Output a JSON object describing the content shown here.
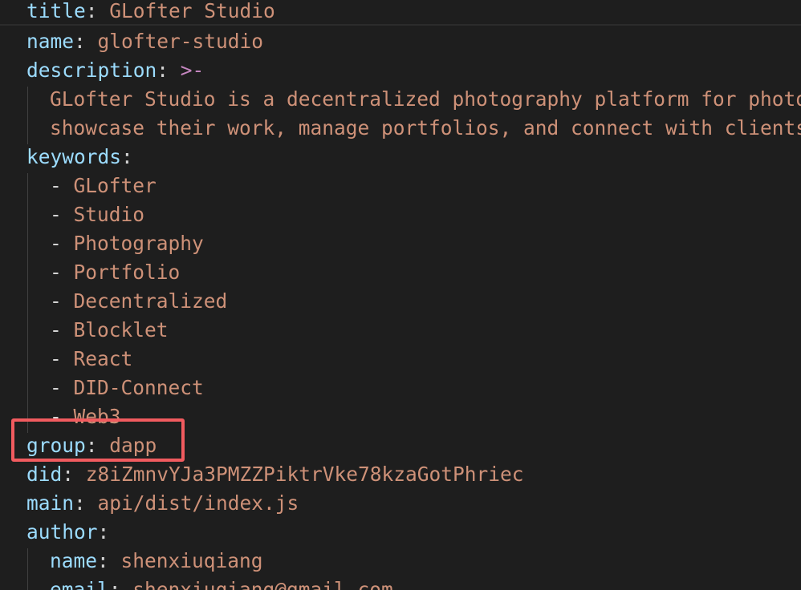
{
  "code": {
    "title_key": "title",
    "title_value": "GLofter Studio",
    "name_key": "name",
    "name_value": "glofter-studio",
    "description_key": "description",
    "description_indicator": ">-",
    "description_lines": [
      "GLofter Studio is a decentralized photography platform for photog",
      "showcase their work, manage portfolios, and connect with clients."
    ],
    "keywords_key": "keywords",
    "keywords": [
      "GLofter",
      "Studio",
      "Photography",
      "Portfolio",
      "Decentralized",
      "Blocklet",
      "React",
      "DID-Connect",
      "Web3"
    ],
    "group_key": "group",
    "group_value": "dapp",
    "did_key": "did",
    "did_value": "z8iZmnvYJa3PMZZPiktrVke78kzaGotPhriec",
    "main_key": "main",
    "main_value": "api/dist/index.js",
    "author_key": "author",
    "author_name_key": "name",
    "author_name_value": "shenxiuqiang",
    "author_email_key": "email",
    "author_email_value": "shenxiuqiang@gmail.com"
  },
  "colors": {
    "background": "#1e1e1e",
    "key": "#9cdcfe",
    "string": "#ce9178",
    "operator": "#c586c0",
    "highlight_box": "#f15b5f"
  }
}
